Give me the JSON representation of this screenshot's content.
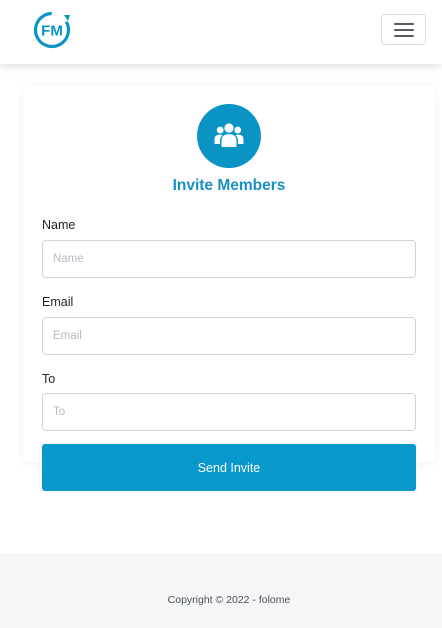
{
  "header": {
    "logo_text": "FM",
    "logo_icon": "fm-logo-icon",
    "menu_icon": "hamburger-menu-icon"
  },
  "colors": {
    "brand_blue": "#0a94c6",
    "title_blue": "#1a8fc2",
    "button_blue": "#0898cc",
    "footer_bg": "#f5f6f8"
  },
  "invite_form": {
    "icon": "users-group-icon",
    "title": "Invite Members",
    "fields": [
      {
        "label": "Name",
        "placeholder": "Name",
        "value": ""
      },
      {
        "label": "Email",
        "placeholder": "Email",
        "value": ""
      },
      {
        "label": "To",
        "placeholder": "To",
        "value": ""
      }
    ],
    "submit_label": "Send Invite"
  },
  "footer": {
    "copyright": "Copyright © 2022 - folome"
  }
}
